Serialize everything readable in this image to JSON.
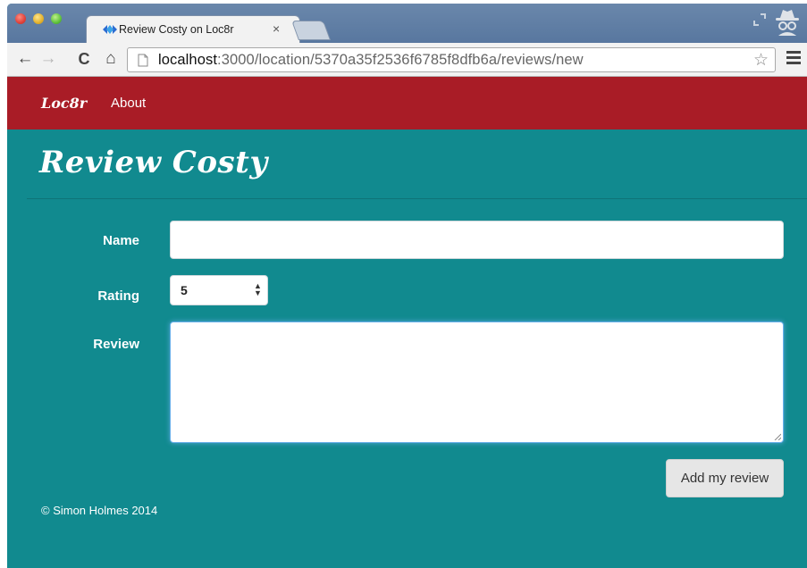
{
  "browser": {
    "tab_title": "Review Costy on Loc8r",
    "tab_close": "×",
    "url_host": "localhost",
    "url_path": ":3000/location/5370a35f2536f6785f8dfb6a/reviews/new",
    "icons": [
      "back-icon",
      "forward-icon",
      "reload-icon",
      "home-icon",
      "page-icon",
      "bookmark-star-icon",
      "menu-icon",
      "incognito-icon",
      "fullscreen-icon"
    ]
  },
  "navbar": {
    "brand": "Loc8r",
    "about": "About"
  },
  "page": {
    "title": "Review Costy"
  },
  "form": {
    "name_label": "Name",
    "name_value": "",
    "rating_label": "Rating",
    "rating_value": "5",
    "review_label": "Review",
    "review_value": "",
    "submit_label": "Add my review"
  },
  "footer": {
    "text": "© Simon Holmes 2014"
  },
  "colors": {
    "navbar": "#a91c26",
    "background": "#118a8f",
    "button": "#e6e6e6"
  }
}
